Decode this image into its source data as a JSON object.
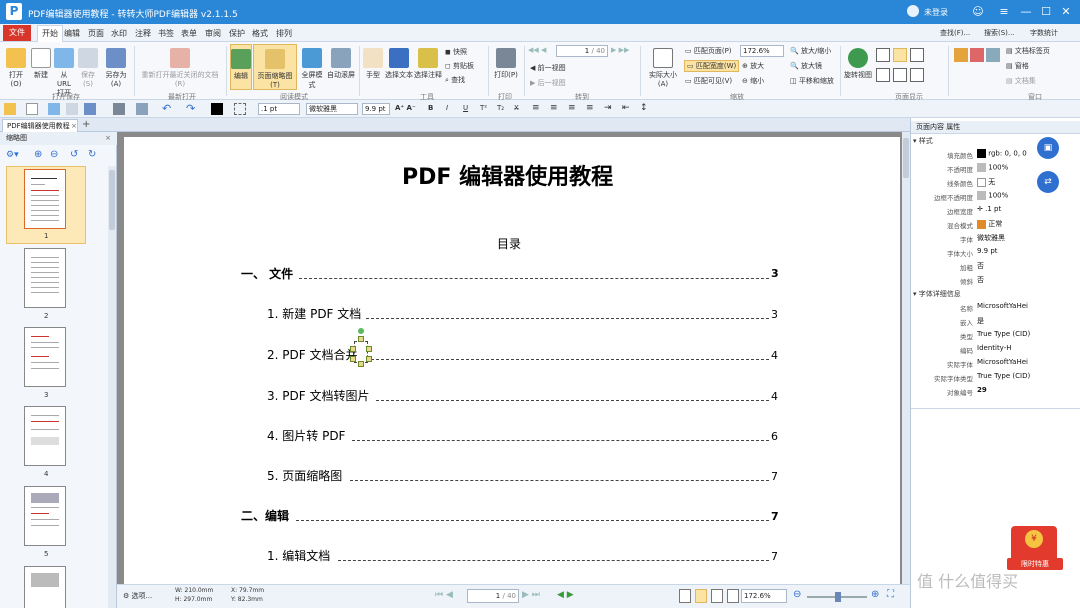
{
  "app": {
    "title": "PDF编辑器使用教程 - 转转大师PDF编辑器 v2.1.1.5",
    "logo": "P",
    "login": "未登录"
  },
  "menu": {
    "file": "文件",
    "items": [
      "开始",
      "编辑",
      "页面",
      "水印",
      "注释",
      "书签",
      "表单",
      "审阅",
      "保护",
      "格式",
      "排列"
    ],
    "active": "开始"
  },
  "ribbon": {
    "groups": {
      "open_save": "打开保存",
      "recent": "最新打开",
      "readmode": "阅读模式",
      "tools": "工具",
      "print": "打印",
      "nav": "转到",
      "zoom": "缩放",
      "pagedisp": "页面显示",
      "window": "窗口"
    },
    "open": "打开(O)",
    "new": "新建",
    "url": "从 URL 打开",
    "save": "保存(S)",
    "saveas": "另存为(A)",
    "reopen": "重新打开最近关闭的文档(R)",
    "edit": "编辑",
    "thumbview": "页面缩略图(T)",
    "fullscreen": "全屏模式",
    "autoscroll": "自动滚屏",
    "hand": "手型",
    "selecttext": "选择文本",
    "selectnote": "选择注释",
    "snapshot": "快照",
    "clipboard": "剪贴板",
    "find": "查找",
    "print": "打印(P)",
    "page_input": "1",
    "page_total": "/ 40",
    "prev_view": "前一视图",
    "next_view": "后一视图",
    "actual_size": "实际大小(A)",
    "fit_page": "匹配页面(P)",
    "fit_width": "匹配宽度(W)",
    "fit_visible": "匹配可见(V)",
    "zoom_value": "172.6%",
    "zoom_out": "放大/缩小",
    "magnify": "放大",
    "shrink": "缩小",
    "magnifier": "放大镜",
    "pan_zoom": "平移和缩放",
    "rotate": "旋转视图",
    "find_f": "查找(F)...",
    "search_s": "搜索(S)...",
    "wordcount": "字数统计",
    "doctab": "文档标签页",
    "tile": "窗格",
    "doclist": "文档集"
  },
  "toolbar": {
    "stroke": ".1 pt",
    "font": "微软雅黑",
    "size": "9.9 pt"
  },
  "tab": {
    "label": "PDF编辑器使用教程"
  },
  "left": {
    "title": "缩略图",
    "pages": [
      "1",
      "2",
      "3",
      "4",
      "5"
    ]
  },
  "page": {
    "title": "PDF 编辑器使用教程",
    "toc": "目录",
    "entries": [
      {
        "label": "一、  文件",
        "page": "3",
        "bold": true
      },
      {
        "label": "1. 新建 PDF 文档",
        "page": "3",
        "bold": false
      },
      {
        "label": "2. PDF 文档合并",
        "page": "4",
        "bold": false
      },
      {
        "label": "3. PDF 文档转图片",
        "page": "4",
        "bold": false
      },
      {
        "label": "4. 图片转 PDF",
        "page": "6",
        "bold": false
      },
      {
        "label": "5. 页面缩略图",
        "page": "7",
        "bold": false
      },
      {
        "label": "二、编辑",
        "page": "7",
        "bold": true
      },
      {
        "label": "1. 编辑文档",
        "page": "7",
        "bold": false
      }
    ]
  },
  "status": {
    "select": "选项...",
    "w": "W: 210.0mm",
    "h": "H: 297.0mm",
    "x": "X: 79.7mm",
    "y": "Y: 82.3mm",
    "page": "1",
    "total": "/ 40",
    "zoom": "172.6%"
  },
  "right": {
    "title": "页面内容 属性",
    "sec_style": "样式",
    "props": [
      {
        "k": "填充颜色",
        "v": "rgb: 0, 0, 0"
      },
      {
        "k": "不透明度",
        "v": "100%"
      },
      {
        "k": "线条颜色",
        "v": "无"
      },
      {
        "k": "边框不透明度",
        "v": "100%"
      },
      {
        "k": "边框宽度",
        "v": ".1 pt"
      },
      {
        "k": "混合模式",
        "v": "正常"
      },
      {
        "k": "字体",
        "v": "微软雅黑"
      },
      {
        "k": "字体大小",
        "v": "9.9 pt"
      },
      {
        "k": "加粗",
        "v": "否"
      },
      {
        "k": "倾斜",
        "v": "否"
      }
    ],
    "sec_font": "字体详细信息",
    "font": [
      {
        "k": "名称",
        "v": "MicrosoftYaHei"
      },
      {
        "k": "嵌入",
        "v": "是"
      },
      {
        "k": "类型",
        "v": "True Type (CID)"
      },
      {
        "k": "编码",
        "v": "Identity-H"
      },
      {
        "k": "实际字体",
        "v": "MicrosoftYaHei"
      },
      {
        "k": "实际字体类型",
        "v": "True Type (CID)"
      },
      {
        "k": "对象编号",
        "v": "29"
      }
    ]
  },
  "promo": {
    "label": "限时特惠"
  },
  "watermark": {
    "text": "值 什么值得买"
  }
}
